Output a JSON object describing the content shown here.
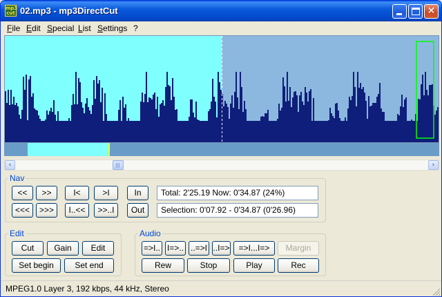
{
  "window": {
    "title": "02.mp3 - mp3DirectCut",
    "icon_text": "mp3 cut"
  },
  "menu": [
    "File",
    "Edit",
    "Special",
    "List",
    "Settings",
    "?"
  ],
  "scrollbar": {
    "left_arrow": "‹",
    "right_arrow": "›"
  },
  "nav": {
    "label": "Nav",
    "buttons_row1": [
      "<<",
      ">>",
      "I<",
      ">I",
      "In"
    ],
    "buttons_row2": [
      "<<<",
      ">>>",
      "I..<<",
      ">>..I",
      "Out"
    ],
    "time_readout": "Total: 2'25.19  Now: 0'34.87  (24%)",
    "selection_readout": "Selection: 0'07.92 - 0'34.87 (0'26.96)"
  },
  "edit": {
    "label": "Edit",
    "buttons_row1": [
      "Cut",
      "Gain",
      "Edit"
    ],
    "buttons_row2": [
      "Set begin",
      "Set end"
    ]
  },
  "audio": {
    "label": "Audio",
    "buttons_row1": [
      "=>I..",
      "I=>..",
      "..=>I",
      "..I=>",
      "=>I...I=>",
      "Margin"
    ],
    "buttons_row2": [
      "Rew",
      "Stop",
      "Play",
      "Rec"
    ]
  },
  "status": {
    "text": "MPEG1.0 Layer 3, 192 kbps, 44 kHz, Stereo"
  },
  "colors": {
    "selection": "#80ffff",
    "waveform": "#0f1e7a",
    "wave_background": "#8cb8e0",
    "marker_box": "#00ff00",
    "overview_marker": "#ffff00"
  },
  "waveform": {
    "selection_fraction": 0.5,
    "playhead_fraction": 0.5,
    "overview_selection": [
      0.054,
      0.243
    ]
  }
}
